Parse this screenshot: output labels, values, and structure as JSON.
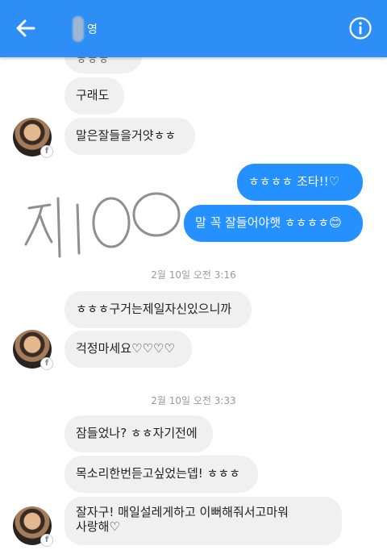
{
  "header": {
    "contact_name_visible": "영",
    "accent": "#2d8ff5"
  },
  "icons": {
    "back": "back-arrow-icon",
    "info": "info-icon"
  },
  "messages": {
    "m0": "ㅎㅎㅎ",
    "m1": "구래도",
    "m2": "말은잘들을거얏ㅎㅎ",
    "o1": "ㅎㅎㅎㅎ 조타!!♡",
    "o2": "말 꼭 잘들어야햇 ㅎㅎㅎㅎ😊",
    "t1": "2월 10일 오전 3:16",
    "m3": "ㅎㅎㅎ구거는제일자신있으니까",
    "m4": "걱정마세요♡♡♡♡",
    "t2": "2월 10일 오전 3:33",
    "m5": "잠들었나? ㅎㅎ자기전에",
    "m6": "목소리한번듣고싶었는뎁! ㅎㅎㅎ",
    "m7_line1": "잘자구! 매일설레게하고 이뻐해줘서고마워",
    "m7_line2": "사랑해♡"
  },
  "handwriting": "지100",
  "avatar_badge": "f"
}
